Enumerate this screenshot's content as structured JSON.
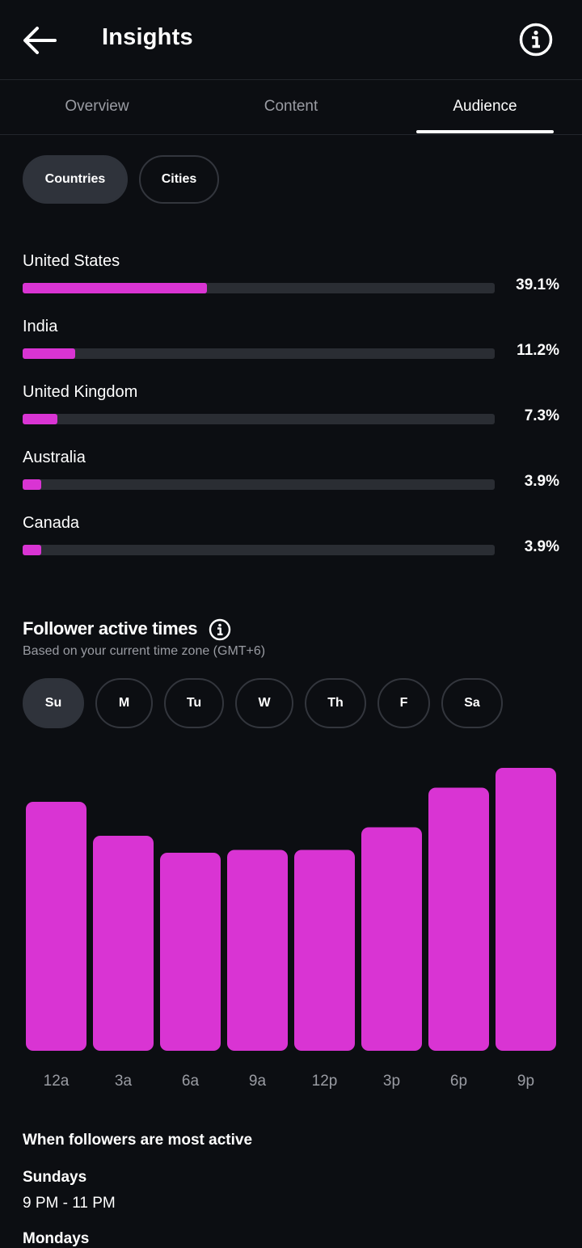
{
  "header": {
    "title": "Insights",
    "back_icon": "arrow-left-icon",
    "info_icon": "info-circle-icon"
  },
  "tabs": [
    {
      "label": "Overview",
      "active": false
    },
    {
      "label": "Content",
      "active": false
    },
    {
      "label": "Audience",
      "active": true
    }
  ],
  "location_filter": {
    "options": [
      {
        "label": "Countries",
        "selected": true
      },
      {
        "label": "Cities",
        "selected": false
      }
    ]
  },
  "countries": [
    {
      "name": "United States",
      "pct_label": "39.1%",
      "value": 39.1
    },
    {
      "name": "India",
      "pct_label": "11.2%",
      "value": 11.2
    },
    {
      "name": "United Kingdom",
      "pct_label": "7.3%",
      "value": 7.3
    },
    {
      "name": "Australia",
      "pct_label": "3.9%",
      "value": 3.9
    },
    {
      "name": "Canada",
      "pct_label": "3.9%",
      "value": 3.9
    }
  ],
  "active_times": {
    "title": "Follower active times",
    "subtitle": "Based on your current time zone (GMT+6)",
    "days": [
      {
        "label": "Su",
        "selected": true
      },
      {
        "label": "M",
        "selected": false
      },
      {
        "label": "Tu",
        "selected": false
      },
      {
        "label": "W",
        "selected": false
      },
      {
        "label": "Th",
        "selected": false
      },
      {
        "label": "F",
        "selected": false
      },
      {
        "label": "Sa",
        "selected": false
      }
    ]
  },
  "chart_data": {
    "type": "bar",
    "categories": [
      "12a",
      "3a",
      "6a",
      "9a",
      "12p",
      "3p",
      "6p",
      "9p"
    ],
    "values": [
      88,
      76,
      70,
      71,
      71,
      79,
      93,
      100
    ],
    "ylim": [
      0,
      100
    ],
    "grid": false,
    "color": "#d934d3"
  },
  "most_active": {
    "title": "When followers are most active",
    "entries": [
      {
        "day": "Sundays",
        "time": "9 PM - 11 PM"
      },
      {
        "day": "Mondays",
        "time": ""
      }
    ]
  },
  "colors": {
    "accent": "#d934d3",
    "background": "#0c0e12",
    "track": "#2a2d33"
  }
}
